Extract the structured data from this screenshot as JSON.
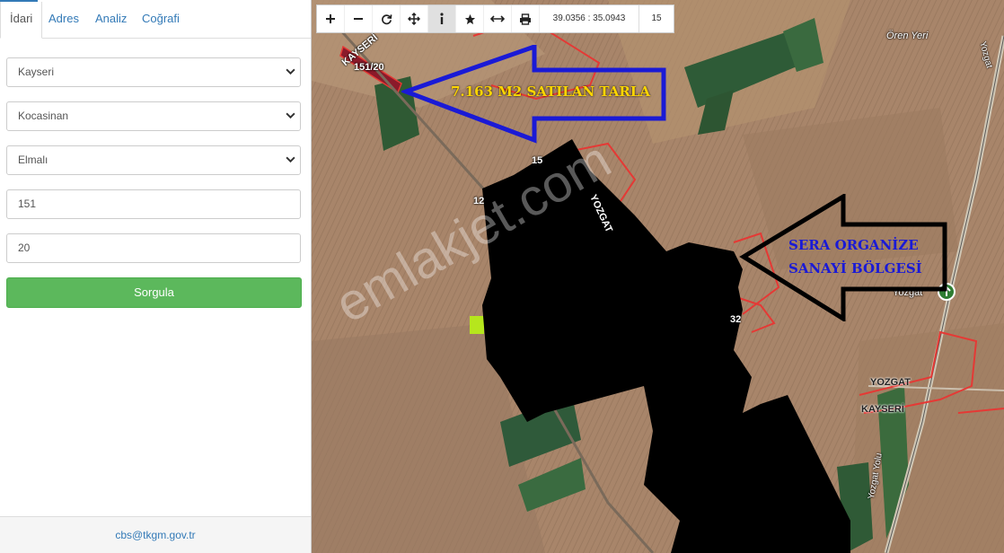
{
  "tabs": [
    {
      "label": "İdari",
      "active": true
    },
    {
      "label": "Adres",
      "active": false
    },
    {
      "label": "Analiz",
      "active": false
    },
    {
      "label": "Coğrafi",
      "active": false
    }
  ],
  "form": {
    "province": "Kayseri",
    "district": "Kocasinan",
    "neighborhood": "Elmalı",
    "block": "151",
    "parcel": "20",
    "submit_label": "Sorgula"
  },
  "footer": {
    "email": "cbs@tkgm.gov.tr"
  },
  "toolbar": {
    "coords": "39.0356 : 35.0943",
    "zoom": "15",
    "icons": [
      "zoom-in-icon",
      "zoom-out-icon",
      "refresh-icon",
      "pan-icon",
      "info-icon",
      "star-icon",
      "measure-icon",
      "print-icon"
    ]
  },
  "map": {
    "labels": {
      "parcel": "151/20",
      "road_kayseri_top": "KAYSERİ",
      "road_yozgat_mid": "YOZGAT",
      "place_oren": "Ören Yeri",
      "place_yozgat": "Yozgat",
      "road_yozgat_bottom": "YOZGAT",
      "road_kayseri_bottom": "KAYSERİ",
      "road_yozgatyolu": "Yozgat Yolu",
      "road_yozgat_right": "Yozgat",
      "parcel_12": "12",
      "parcel_32": "32",
      "parcel_15": "15"
    },
    "annotations": {
      "field_sale": "7.163 M2 SATILAN TARLA",
      "industrial_line1": "SERA ORGANİZE",
      "industrial_line2": "SANAYİ BÖLGESİ"
    },
    "watermark": "emlakjet.com",
    "colors": {
      "parcel_boundary": "#e53935",
      "arrow_blue": "#1a1ad6",
      "annotation_yellow": "#ffd600"
    }
  }
}
